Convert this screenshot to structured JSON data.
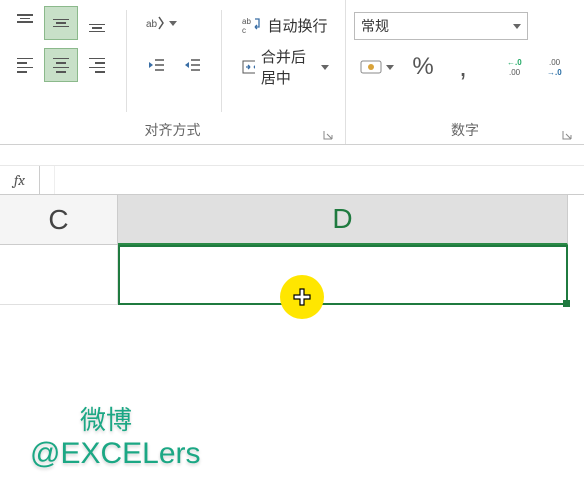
{
  "ribbon": {
    "align_group_label": "对齐方式",
    "number_group_label": "数字",
    "wrap_text": "自动换行",
    "merge_center": "合并后居中",
    "number_format_selected": "常规",
    "percent_symbol": "%",
    "comma_symbol": ","
  },
  "fx": {
    "label": "fx",
    "value": ""
  },
  "columns": {
    "c": "C",
    "d": "D"
  },
  "watermark": {
    "line1": "微博",
    "line2": "@EXCELers"
  }
}
